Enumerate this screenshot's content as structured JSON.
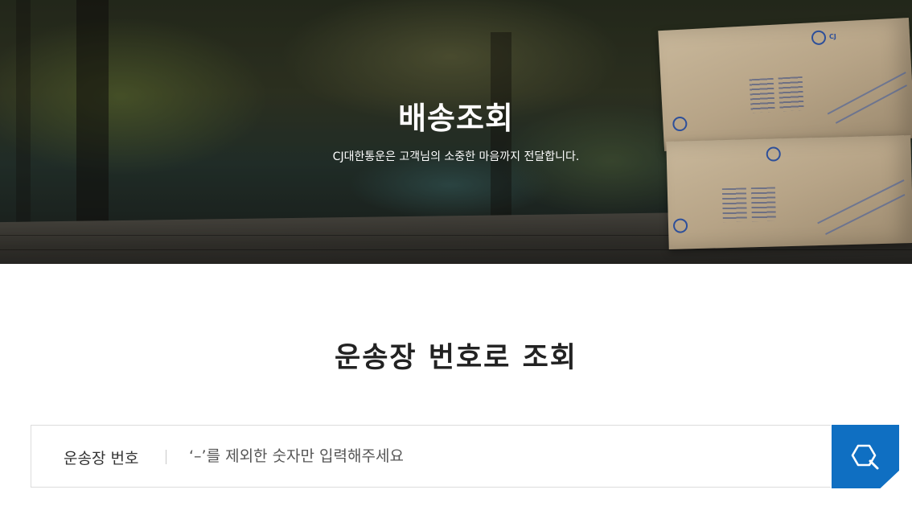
{
  "hero": {
    "title": "배송조회",
    "subtitle": "CJ대한통운은 고객님의 소중한 마음까지 전달합니다."
  },
  "tracking": {
    "section_title": "운송장 번호로 조회",
    "field_label": "운송장 번호",
    "input_value": "",
    "placeholder": "‘–’를 제외한 숫자만 입력해주세요",
    "search_icon": "search-icon"
  },
  "colors": {
    "accent": "#0f6fc2",
    "title_text": "#222222",
    "border": "#dcdcdc"
  }
}
